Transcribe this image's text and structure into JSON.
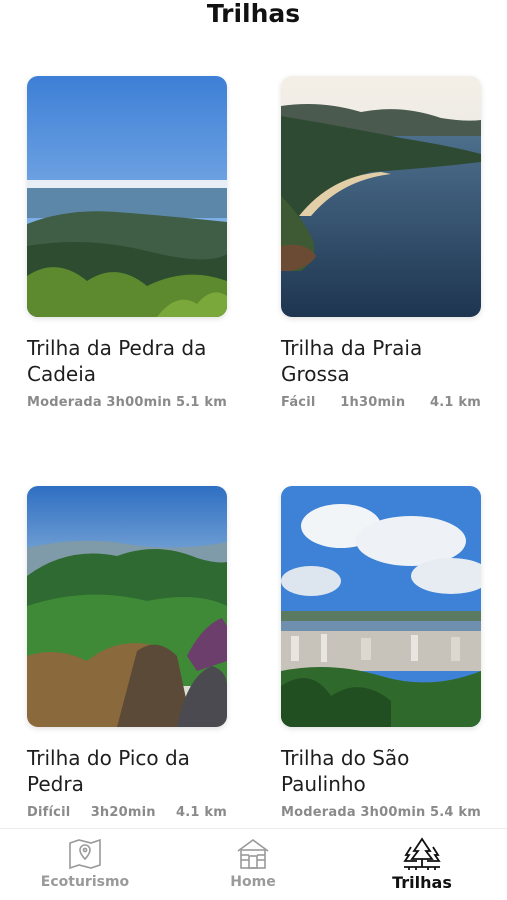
{
  "header": {
    "title": "Trilhas"
  },
  "trails": [
    {
      "name": "Trilha da Pedra da Cadeia",
      "difficulty": "Moderada",
      "duration": "3h00min",
      "distance": "5.1 km"
    },
    {
      "name": "Trilha da Praia Grossa",
      "difficulty": "Fácil",
      "duration": "1h30min",
      "distance": "4.1 km"
    },
    {
      "name": "Trilha do Pico da Pedra",
      "difficulty": "Difícil",
      "duration": "3h20min",
      "distance": "4.1 km"
    },
    {
      "name": "Trilha do São Paulinho",
      "difficulty": "Moderada",
      "duration": "3h00min",
      "distance": "5.4 km"
    }
  ],
  "tabbar": {
    "items": [
      {
        "label": "Ecoturismo",
        "icon": "map-pin-icon",
        "active": false
      },
      {
        "label": "Home",
        "icon": "house-icon",
        "active": false
      },
      {
        "label": "Trilhas",
        "icon": "pine-trees-icon",
        "active": true
      }
    ]
  },
  "colors": {
    "active_tab": "#111111",
    "inactive_tab": "#9a9a9a",
    "meta_text": "#8a8a8a"
  }
}
